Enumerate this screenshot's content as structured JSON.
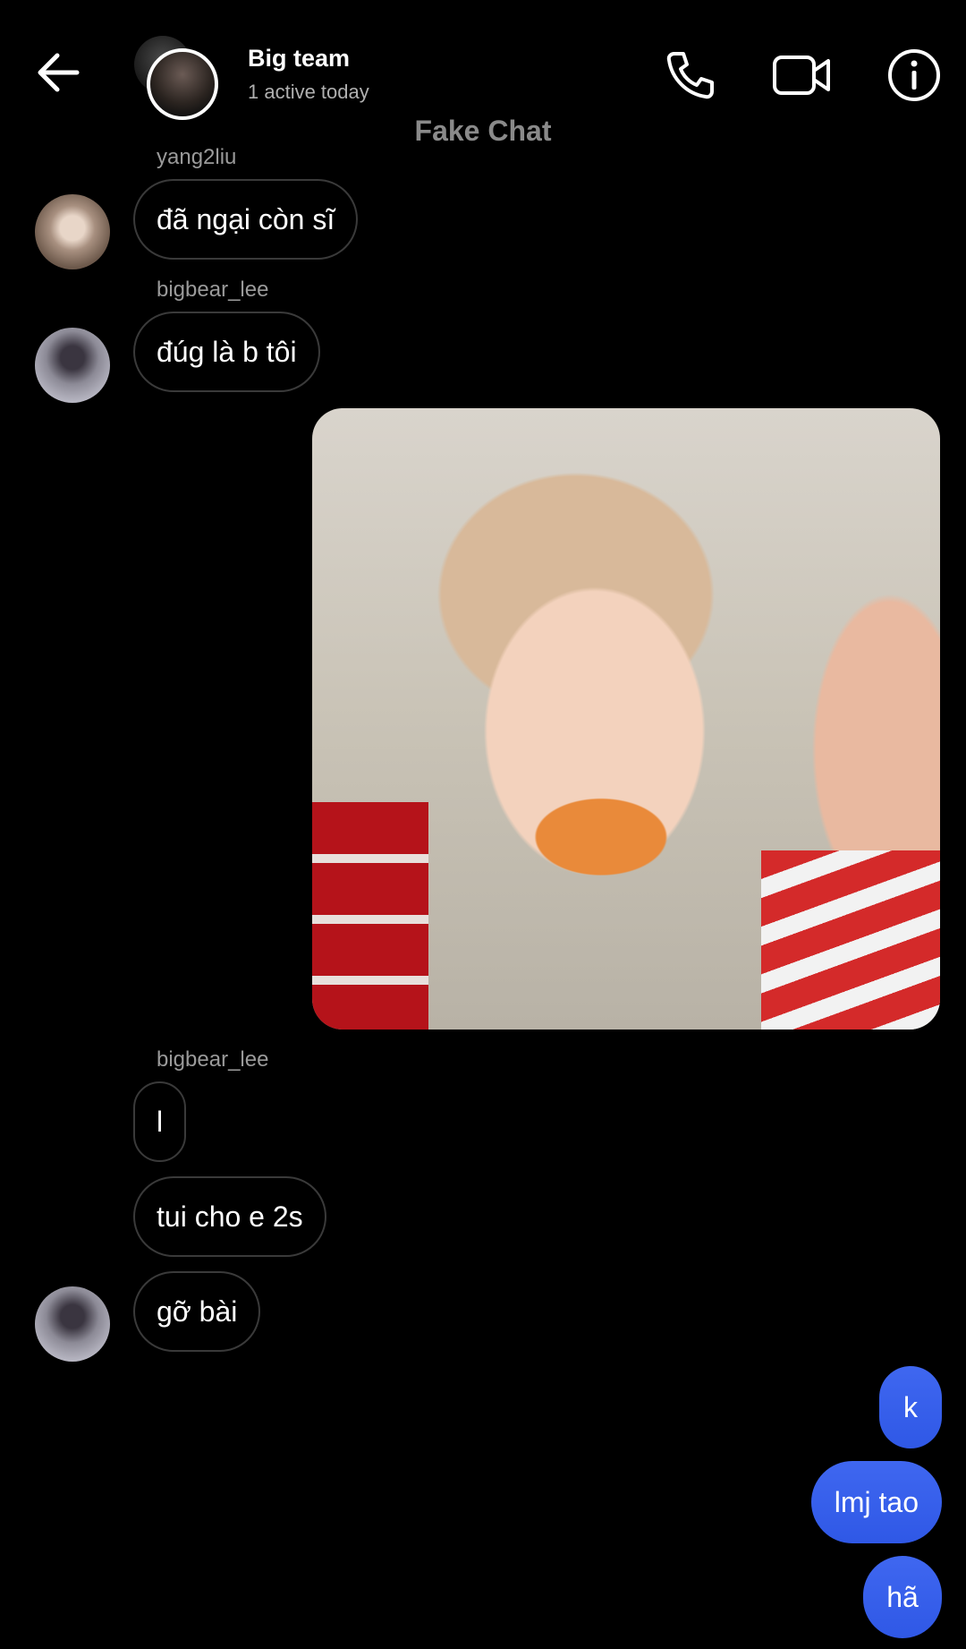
{
  "header": {
    "title": "Big team",
    "subtitle": "1 active today"
  },
  "watermark": "Fake Chat",
  "messages": [
    {
      "sender": "yang2liu",
      "text": "đã ngại còn sĩ"
    },
    {
      "sender": "bigbear_lee",
      "text": "đúg là b tôi"
    },
    {
      "sender": "bigbear_lee",
      "texts": [
        "l",
        "tui cho e 2s",
        "gỡ bài"
      ]
    }
  ],
  "my_messages": [
    "k",
    "lmj tao",
    "hã"
  ],
  "colors": {
    "background": "#000000",
    "incoming_border": "#3a3a3a",
    "outgoing_bubble": "#3461ec",
    "secondary_text": "#9a9a9a"
  }
}
